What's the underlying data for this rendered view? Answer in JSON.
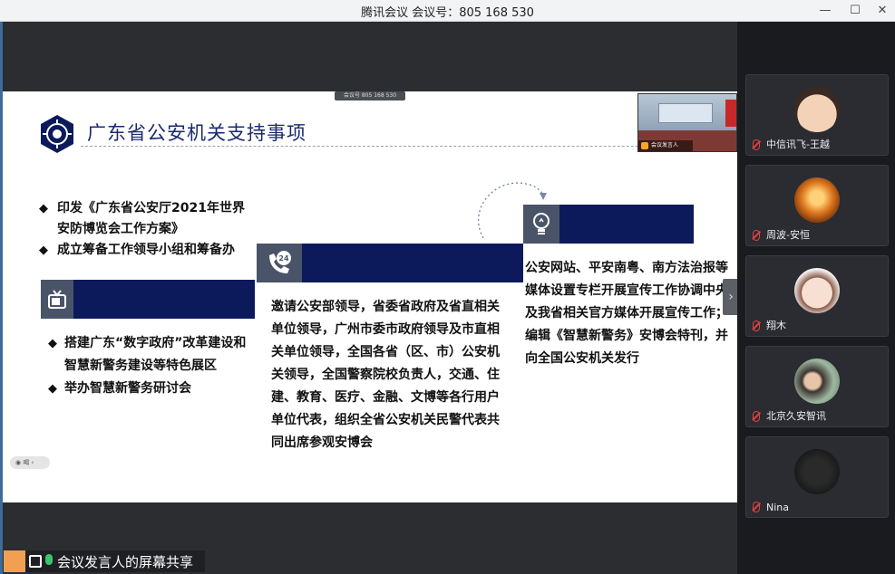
{
  "window": {
    "title": "腾讯会议 会议号：805 168 530",
    "minimize": "—",
    "maximize": "☐",
    "close": "✕"
  },
  "slide": {
    "meeting_tag": "会议号 805 168 530",
    "title": "广东省公安机关支持事项",
    "top_bullets": [
      "印发《广东省公安厅2021年世界安防博览会工作方案》",
      "成立筹备工作领导小组和筹备办"
    ],
    "left_bullets": [
      "搭建广东“数字政府”改革建设和智慧新警务建设等特色展区",
      "举办智慧新警务研讨会"
    ],
    "middle_text": "邀请公安部领导，省委省政府及省直相关单位领导，广州市委市政府领导及市直相关单位领导，全国各省（区、市）公安机关领导，全国警察院校负责人，交通、住建、教育、医疗、金融、文博等各行用户单位代表，组织全省公安机关民警代表共同出席参观安博会",
    "right_text": "公安网站、平安南粤、南方法治报等媒体设置专栏开展宣传工作协调中央及我省相关官方媒体开展宣传工作；编辑《智慧新警务》安博会特刊，并向全国公安机关发行",
    "cam_label": "会议发言人",
    "pill_label": "◉ 喝 ‹",
    "next_arrow": "›"
  },
  "share_bar": {
    "label": "会议发言人的屏幕共享"
  },
  "participants": [
    {
      "name": "中信讯飞-王越"
    },
    {
      "name": "周波-安恒"
    },
    {
      "name": "翔木"
    },
    {
      "name": "北京久安智讯"
    },
    {
      "name": "Nina"
    }
  ],
  "colors": {
    "slide_header": "#0c1a5c",
    "title": "#1a2a6c",
    "icon_bg": "#4a5468"
  }
}
